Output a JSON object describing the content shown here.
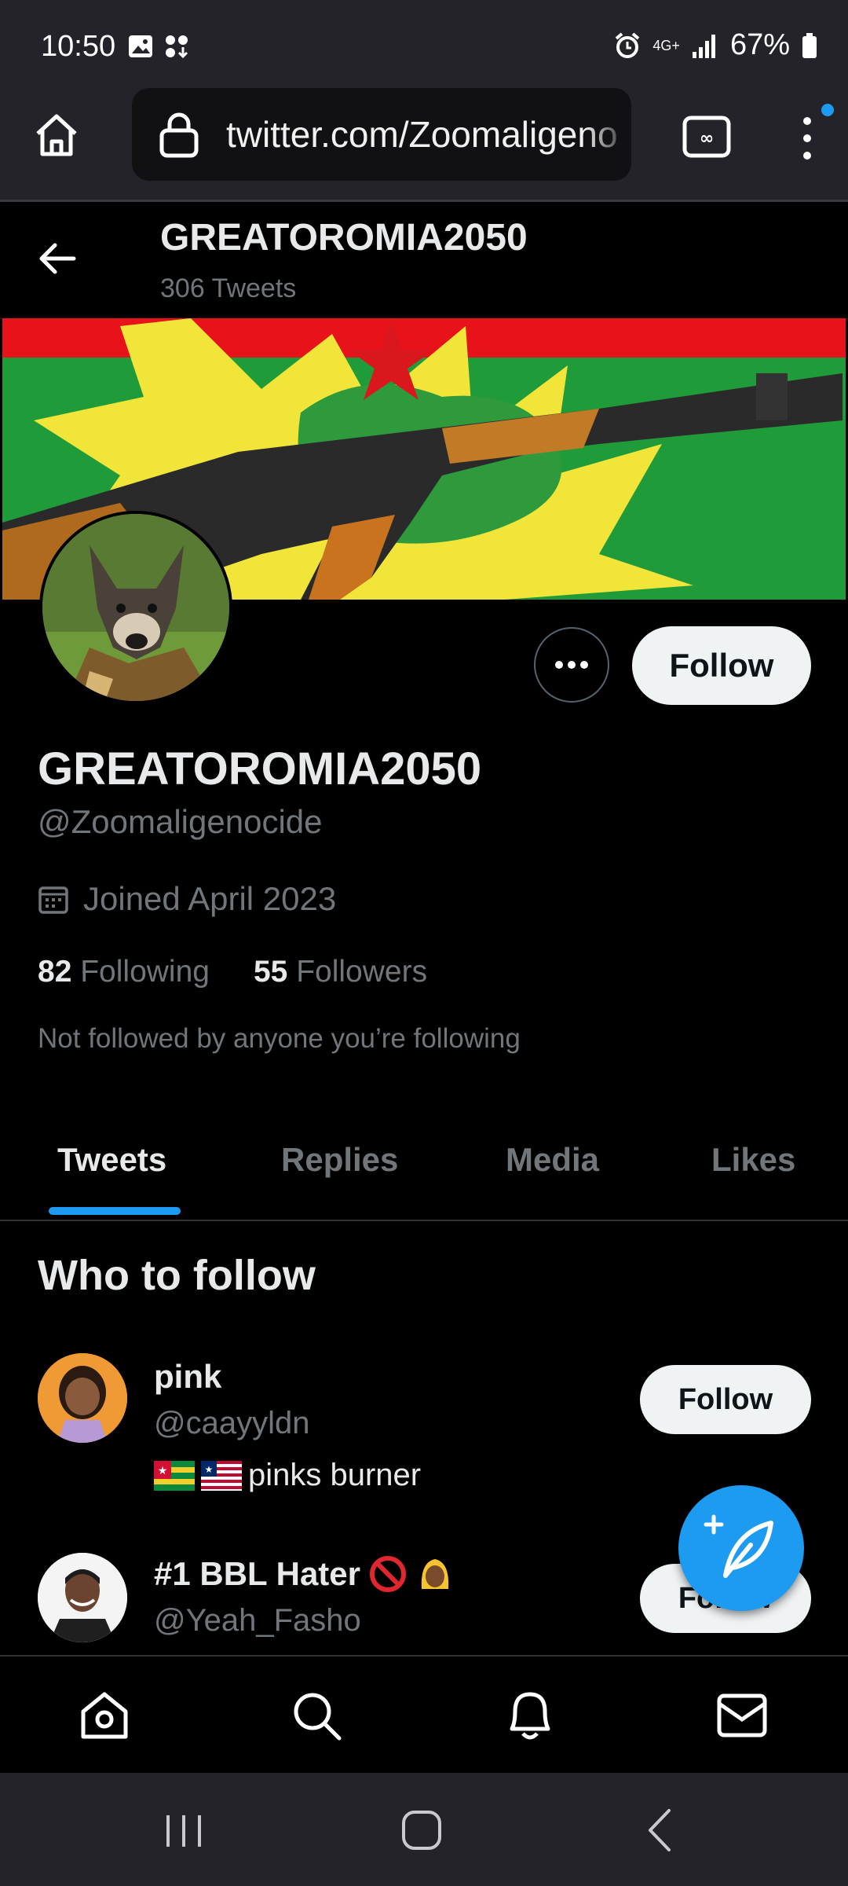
{
  "status_bar": {
    "time": "10:50",
    "battery": "67%",
    "network": "4G+"
  },
  "browser": {
    "url": "twitter.com/Zoomaligenocide",
    "icons": [
      "home-icon",
      "lock-icon",
      "tab-switcher-icon",
      "more-vert-icon"
    ]
  },
  "header": {
    "title": "GREATOROMIA2050",
    "subtitle": "306 Tweets"
  },
  "profile": {
    "name": "GREATOROMIA2050",
    "handle": "@Zoomaligenocide",
    "joined": "Joined April 2023",
    "following_count": "82",
    "following_label": "Following",
    "followers_count": "55",
    "followers_label": "Followers",
    "not_followed": "Not followed by anyone you’re following",
    "follow_label": "Follow"
  },
  "tabs": [
    "Tweets",
    "Replies",
    "Media",
    "Likes"
  ],
  "who_to_follow": {
    "title": "Who to follow",
    "items": [
      {
        "name": "pink",
        "handle": "@caayyldn",
        "bio": "pinks burner",
        "follow_label": "Follow"
      },
      {
        "name": "#1 BBL Hater",
        "handle": "@Yeah_Fasho",
        "follow_label": "Follow"
      }
    ]
  },
  "colors": {
    "accent": "#1d9bf0",
    "background": "#000000",
    "muted_text": "#71767b"
  }
}
